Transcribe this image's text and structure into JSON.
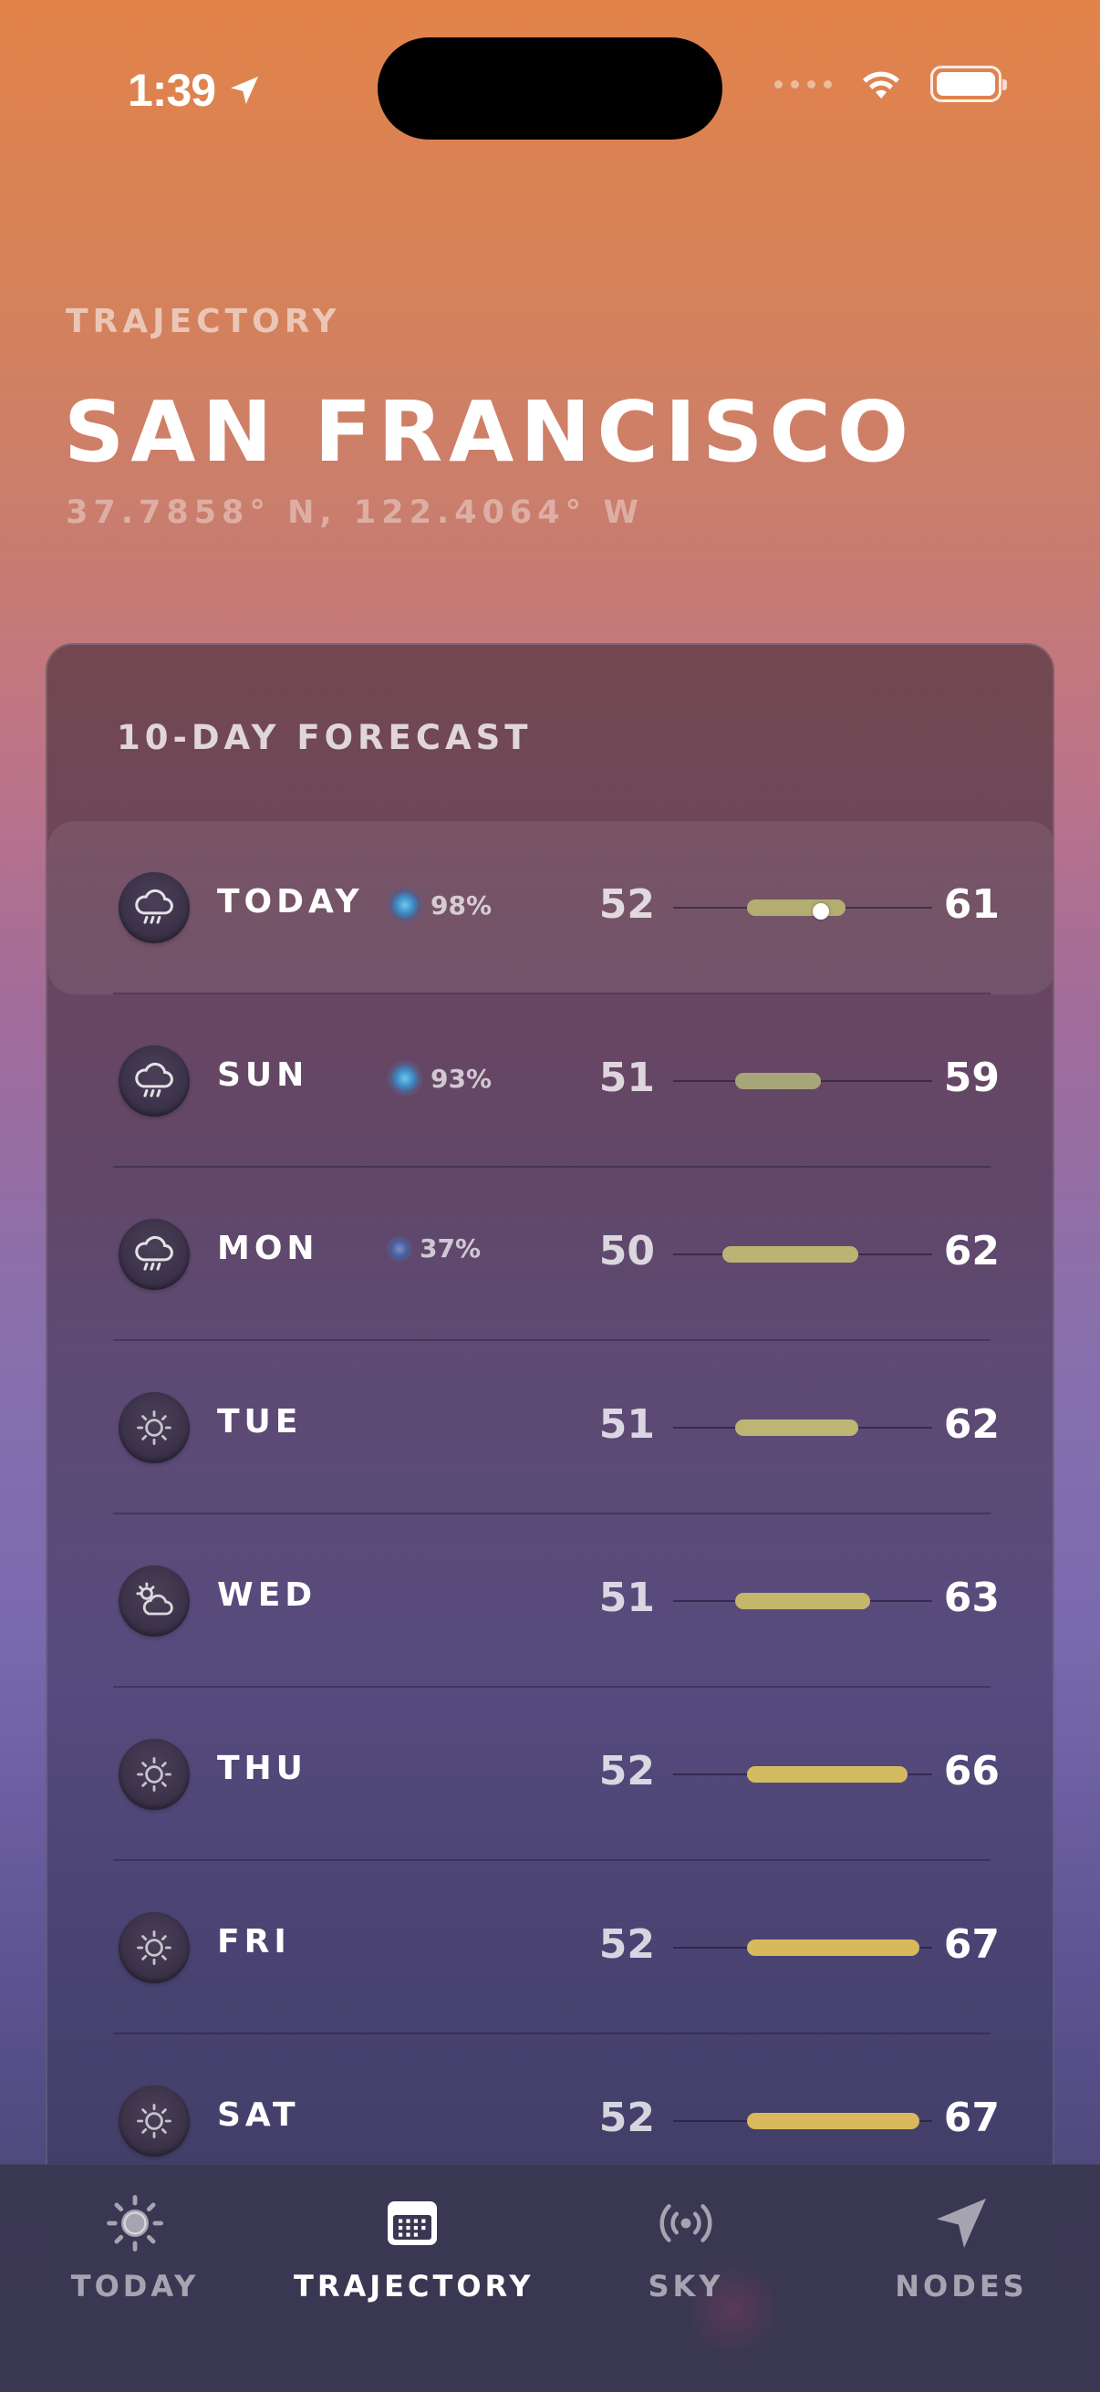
{
  "status_bar": {
    "time": "1:39"
  },
  "header": {
    "section_label": "TRAJECTORY",
    "city": "SAN FRANCISCO",
    "coordinates": "37.7858° N, 122.4064° W"
  },
  "forecast": {
    "title": "10-DAY FORECAST",
    "temp_scale_min": 46,
    "temp_scale_max": 67,
    "days": [
      {
        "day": "TODAY",
        "icon": "rain-cloud-icon",
        "precip": "98%",
        "low": "52",
        "high": "61",
        "bar_start": 52,
        "bar_end": 60,
        "current_temp": 58,
        "bar_color": "#b3ad72"
      },
      {
        "day": "SUN",
        "icon": "rain-cloud-icon",
        "precip": "93%",
        "low": "51",
        "high": "59",
        "bar_start": 51,
        "bar_end": 58,
        "bar_color": "#a7a57a"
      },
      {
        "day": "MON",
        "icon": "rain-cloud-icon",
        "precip": "37%",
        "low": "50",
        "high": "62",
        "bar_start": 50,
        "bar_end": 61,
        "bar_color": "#bab474"
      },
      {
        "day": "TUE",
        "icon": "sun-icon",
        "precip": "",
        "low": "51",
        "high": "62",
        "bar_start": 51,
        "bar_end": 61,
        "bar_color": "#bdb672"
      },
      {
        "day": "WED",
        "icon": "partly-cloudy-icon",
        "precip": "",
        "low": "51",
        "high": "63",
        "bar_start": 51,
        "bar_end": 62,
        "bar_color": "#c4b76c"
      },
      {
        "day": "THU",
        "icon": "sun-icon",
        "precip": "",
        "low": "52",
        "high": "66",
        "bar_start": 52,
        "bar_end": 65,
        "bar_color": "#d4bb62"
      },
      {
        "day": "FRI",
        "icon": "sun-icon",
        "precip": "",
        "low": "52",
        "high": "67",
        "bar_start": 52,
        "bar_end": 66,
        "bar_color": "#d8ba5c"
      },
      {
        "day": "SAT",
        "icon": "sun-icon",
        "precip": "",
        "low": "52",
        "high": "67",
        "bar_start": 52,
        "bar_end": 66,
        "bar_color": "#d8ba5c"
      }
    ]
  },
  "tabs": [
    {
      "label": "TODAY",
      "icon": "sun-icon",
      "active": false
    },
    {
      "label": "TRAJECTORY",
      "icon": "calendar-icon",
      "active": true
    },
    {
      "label": "SKY",
      "icon": "broadcast-icon",
      "active": false
    },
    {
      "label": "NODES",
      "icon": "location-arrow-icon",
      "active": false
    }
  ]
}
